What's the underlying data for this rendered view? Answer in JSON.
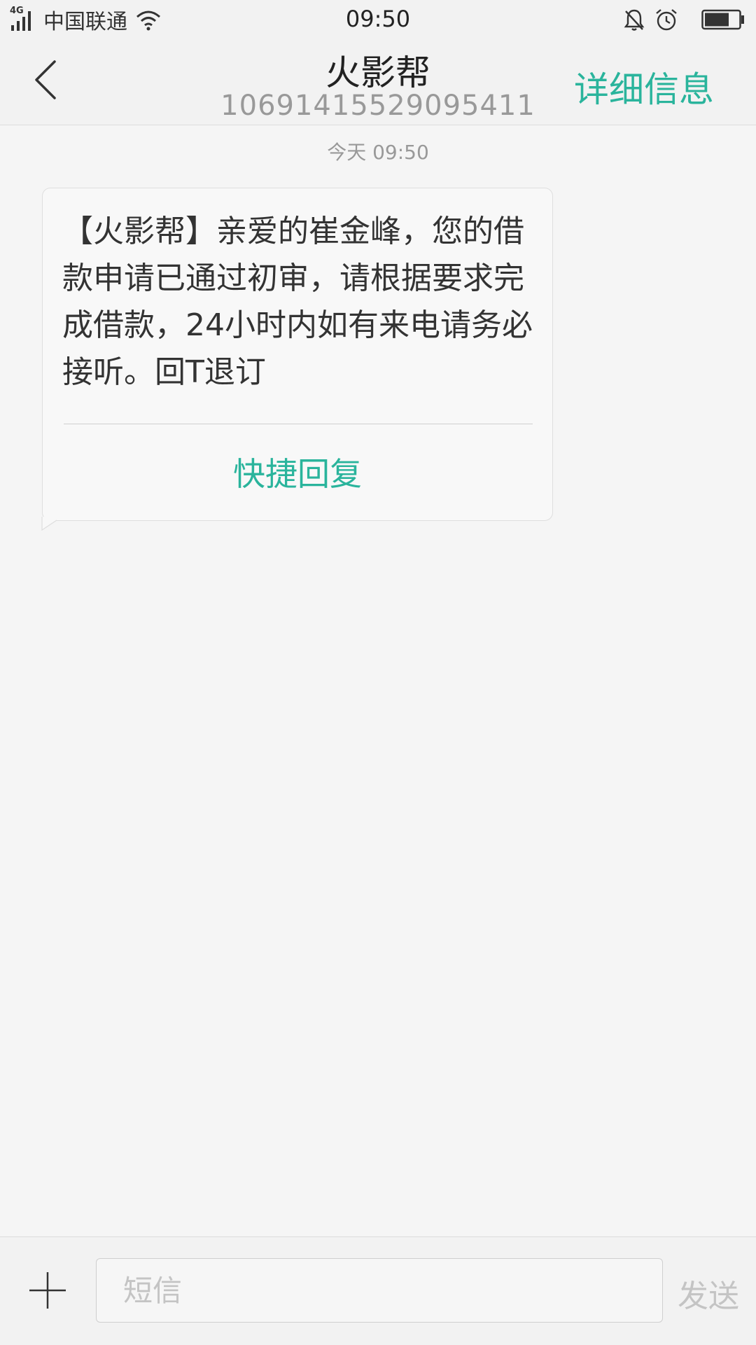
{
  "status_bar": {
    "network_type": "4G",
    "carrier": "中国联通",
    "time": "09:50",
    "icons": [
      "signal-icon",
      "wifi-icon",
      "bell-off-icon",
      "alarm-icon",
      "battery-icon"
    ]
  },
  "header": {
    "contact_name": "火影帮",
    "contact_number": "1069141552909541​1",
    "details_label": "详细信息"
  },
  "conversation": {
    "timestamp": "今天  09:50",
    "messages": [
      {
        "text": "【火影帮】亲爱的崔金峰，您的借款申请已通过初审，请根据要求完成借款，24小时内如有来电请务必接听。回T退订",
        "quick_reply_label": "快捷回复"
      }
    ]
  },
  "composer": {
    "placeholder": "短信",
    "send_label": "发送"
  },
  "colors": {
    "accent": "#2ab49c",
    "background": "#f5f5f5",
    "bar": "#f2f2f2"
  }
}
